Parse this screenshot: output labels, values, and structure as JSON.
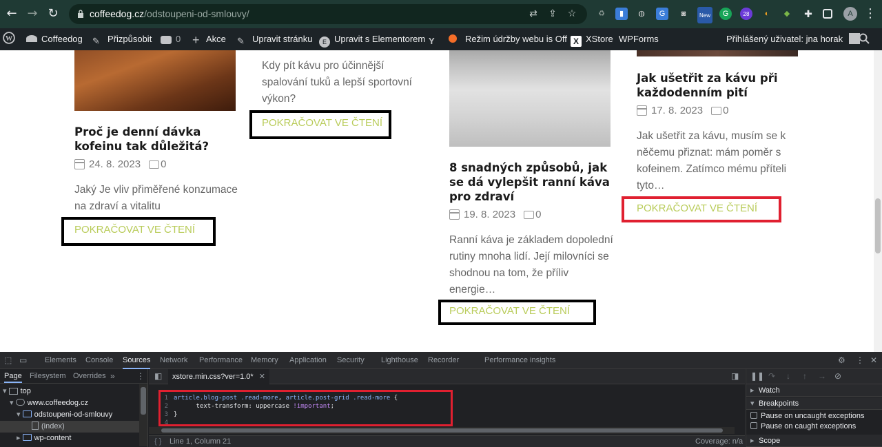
{
  "browser": {
    "url_domain": "coffeedog.cz",
    "url_path": "/odstoupeni-od-smlouvy/",
    "profile_initial": "A",
    "extension_badge_new": "New",
    "extension_badge_count": "28"
  },
  "adminbar": {
    "site": "Coffeedog",
    "customize": "Přizpůsobit",
    "comments_count": "0",
    "new": "Akce",
    "edit_page": "Upravit stránku",
    "edit_elementor": "Upravit s Elementorem",
    "maintenance": "Režim údržby webu is Off",
    "xstore": "XStore",
    "wpforms": "WPForms",
    "logged_in": "Přihlášený uživatel: jna horak"
  },
  "posts": [
    {
      "title": "Proč je denní dávka kofeinu tak důležitá?",
      "date": "24. 8. 2023",
      "comments": "0",
      "excerpt": "Jaký Je vliv přiměřené konzumace na zdraví a vitalitu",
      "read_more": "POKRAČOVAT VE ČTENÍ"
    },
    {
      "excerpt": "Kdy pít kávu pro účinnější spalování tuků a lepší sportovní výkon?",
      "read_more": "POKRAČOVAT VE ČTENÍ"
    },
    {
      "title": "8 snadných způsobů, jak se dá vylepšit ranní káva pro zdraví",
      "date": "19. 8. 2023",
      "comments": "0",
      "excerpt": "Ranní káva je základem dopolední rutiny mnoha lidí. Její milovníci se shodnou na tom, že příliv energie…",
      "read_more": "POKRAČOVAT VE ČTENÍ"
    },
    {
      "title": "Jak ušetřit za kávu při každodenním pití",
      "date": "17. 8. 2023",
      "comments": "0",
      "excerpt": "Jak ušetřit za kávu, musím se k něčemu přiznat: mám poměr s kofeinem. Zatímco mému příteli tyto…",
      "read_more": "POKRAČOVAT VE ČTENÍ"
    }
  ],
  "devtools": {
    "tabs": [
      "Elements",
      "Console",
      "Sources",
      "Network",
      "Performance",
      "Memory",
      "Application",
      "Security",
      "Lighthouse",
      "Recorder",
      "Performance insights"
    ],
    "active_tab": "Sources",
    "nav_tabs": [
      "Page",
      "Filesystem",
      "Overrides"
    ],
    "tree": [
      "top",
      "www.coffeedog.cz",
      "odstoupeni-od-smlouvy",
      "(index)",
      "wp-content"
    ],
    "editor_file": "xstore.min.css?ver=1.0*",
    "code": {
      "line1_selector_a": "article.blog-post .read-more",
      "line1_sep": ", ",
      "line1_selector_b": "article.post-grid .read-more",
      "line1_brace": " {",
      "line2_prop": "text-transform",
      "line2_colon": ": ",
      "line2_val": "uppercase",
      "line2_important": " !important",
      "line2_semi": ";",
      "line3": "}"
    },
    "status_position": "Line 1, Column 21",
    "status_coverage": "Coverage: n/a",
    "panes": {
      "watch": "Watch",
      "breakpoints": "Breakpoints",
      "pause_uncaught": "Pause on uncaught exceptions",
      "pause_caught": "Pause on caught exceptions",
      "scope": "Scope"
    }
  },
  "colors": {
    "read_more_text": "#b9cc5a",
    "highlight_red": "#e02030",
    "chrome_bar": "#1f3a34"
  }
}
